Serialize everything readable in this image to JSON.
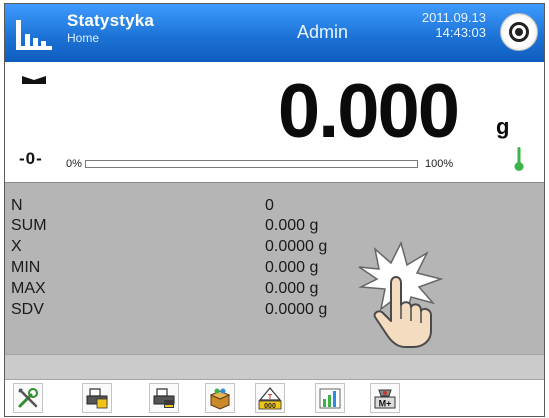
{
  "header": {
    "title": "Statystyka",
    "subtitle": "Home",
    "user": "Admin",
    "date": "2011.09.13",
    "time": "14:43:03",
    "app_icon": "statistics-bars-icon",
    "action_icon": "target-icon"
  },
  "display": {
    "reading": "0.000",
    "unit": "g",
    "zero_marker": "-0-",
    "bar_min_label": "0%",
    "bar_max_label": "100%",
    "bar_fill_fraction": 0.0,
    "stable_icon": "stable-indicator-icon",
    "thermometer_icon": "thermometer-icon"
  },
  "stats": [
    {
      "label": "N",
      "value": "0"
    },
    {
      "label": "SUM",
      "value": "0.000 g"
    },
    {
      "label": "X",
      "value": "0.0000 g"
    },
    {
      "label": "MIN",
      "value": "0.000 g"
    },
    {
      "label": "MAX",
      "value": "0.000 g"
    },
    {
      "label": "SDV",
      "value": "0.0000 g"
    }
  ],
  "hint_icon": "touch-hand-icon",
  "toolbar": {
    "buttons": [
      {
        "name": "settings-tools-icon"
      },
      {
        "name": "print-icon"
      },
      {
        "name": "print-footer-icon"
      },
      {
        "name": "database-box-icon"
      },
      {
        "name": "tare-icon"
      },
      {
        "name": "statistics-chart-icon"
      },
      {
        "name": "add-weighing-icon"
      }
    ]
  },
  "colors": {
    "header_blue": "#1d74d6",
    "panel_gray": "#b5b5b5",
    "bar_blue": "#2b8de9",
    "thermo_green": "#39b54a"
  }
}
